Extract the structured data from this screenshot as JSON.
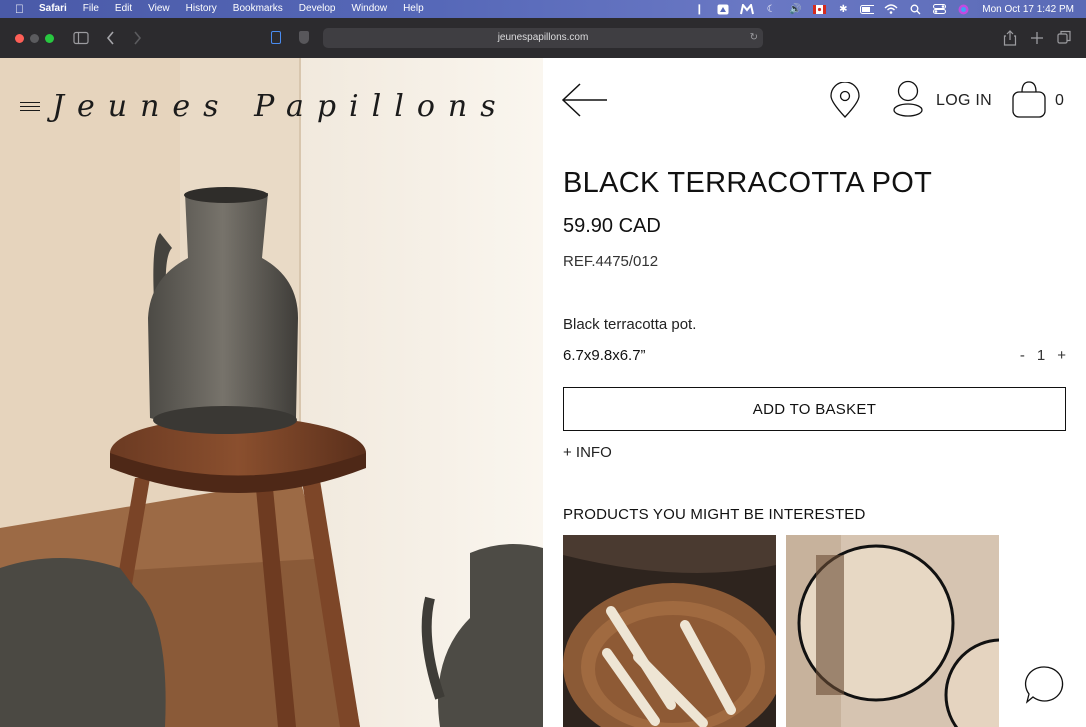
{
  "menubar": {
    "app": "Safari",
    "items": [
      "File",
      "Edit",
      "View",
      "History",
      "Bookmarks",
      "Develop",
      "Window",
      "Help"
    ],
    "status_icons": [
      "figma-icon",
      "drive-icon",
      "malwarebytes-icon",
      "moon-icon",
      "volume-icon",
      "flag-icon",
      "bluetooth-icon",
      "battery-icon",
      "wifi-icon",
      "search-icon",
      "control-center-icon",
      "siri-icon"
    ],
    "clock": "Mon Oct 17  1:42 PM"
  },
  "browser": {
    "url": "jeunespapillons.com"
  },
  "site": {
    "logo": "Jeunes Papillons",
    "login_label": "LOG IN",
    "bag_count": "0"
  },
  "product": {
    "title": "BLACK TERRACOTTA POT",
    "price": "59.90 CAD",
    "ref": "REF.4475/012",
    "description": "Black terracotta pot.",
    "dimensions": "6.7x9.8x6.7”",
    "qty_minus": "-",
    "qty_value": "1",
    "qty_plus": "+",
    "add_to_basket": "ADD TO BASKET",
    "more_info": "+ INFO"
  },
  "related": {
    "title": "PRODUCTS YOU MIGHT BE INTERESTED"
  },
  "colors": {
    "menubar": "#5668b8",
    "toolbar": "#2c2b2e",
    "text": "#111111"
  }
}
